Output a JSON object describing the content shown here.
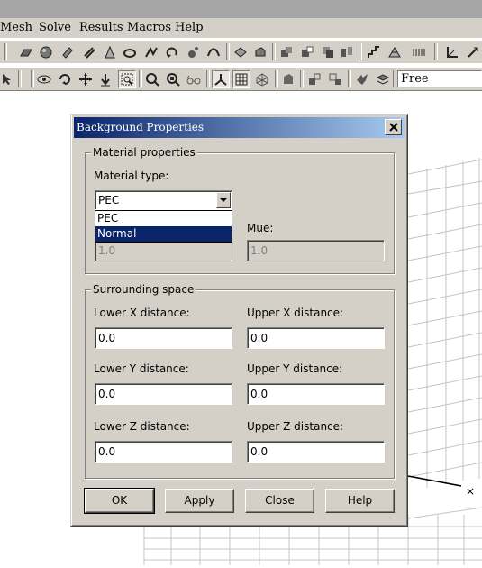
{
  "menubar": {
    "items": [
      "Mesh",
      "Solve",
      "Results",
      "Macros",
      "Help"
    ]
  },
  "toolbar2": {
    "view_mode_value": "Free"
  },
  "dialog": {
    "title": "Background Properties",
    "material_group": {
      "title": "Material properties",
      "material_type_label": "Material type:",
      "material_type_value": "PEC",
      "dropdown_options": [
        "PEC",
        "Normal"
      ],
      "selected_option": "Normal",
      "eps_value": "1.0",
      "mue_label": "Mue:",
      "mue_value": "1.0"
    },
    "surrounding_group": {
      "title": "Surrounding space",
      "lower_x_label": "Lower X distance:",
      "lower_x_value": "0.0",
      "upper_x_label": "Upper X distance:",
      "upper_x_value": "0.0",
      "lower_y_label": "Lower Y distance:",
      "lower_y_value": "0.0",
      "upper_y_label": "Upper Y distance:",
      "upper_y_value": "0.0",
      "lower_z_label": "Lower Z distance:",
      "lower_z_value": "0.0",
      "upper_z_label": "Upper Z distance:",
      "upper_z_value": "0.0"
    },
    "buttons": {
      "ok": "OK",
      "apply": "Apply",
      "close": "Close",
      "help": "Help"
    }
  },
  "scene": {
    "axis_marker": "×"
  },
  "colors": {
    "titlebar_start": "#0a246a",
    "titlebar_end": "#a6caf0",
    "face": "#d4d0c8",
    "selection": "#0a246a"
  }
}
